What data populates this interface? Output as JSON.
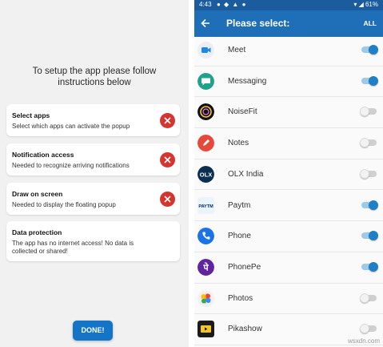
{
  "setup": {
    "intro": "To setup the app please follow instructions below",
    "cards": [
      {
        "title": "Select apps",
        "subtitle": "Select which apps can activate the popup",
        "status": "error"
      },
      {
        "title": "Notification access",
        "subtitle": "Needed to recognize arriving notifications",
        "status": "error"
      },
      {
        "title": "Draw on screen",
        "subtitle": "Needed to display the floating popup",
        "status": "error"
      },
      {
        "title": "Data protection",
        "subtitle": "The app has no internet access! No data is collected or shared!",
        "status": "info"
      }
    ],
    "done_label": "DONE!"
  },
  "status_bar": {
    "time": "4:43",
    "battery": "61%"
  },
  "select": {
    "title": "Please select:",
    "all_label": "ALL",
    "apps": [
      {
        "name": "Meet",
        "enabled": true
      },
      {
        "name": "Messaging",
        "enabled": true
      },
      {
        "name": "NoiseFit",
        "enabled": false
      },
      {
        "name": "Notes",
        "enabled": false
      },
      {
        "name": "OLX India",
        "enabled": false
      },
      {
        "name": "Paytm",
        "enabled": true
      },
      {
        "name": "Phone",
        "enabled": true
      },
      {
        "name": "PhonePe",
        "enabled": true
      },
      {
        "name": "Photos",
        "enabled": false
      },
      {
        "name": "Pikashow",
        "enabled": false
      }
    ]
  },
  "watermark": "wsxdn.com",
  "colors": {
    "accent": "#1f6fb8",
    "error": "#d6342f",
    "toggle_on": "#1f7fc7"
  }
}
